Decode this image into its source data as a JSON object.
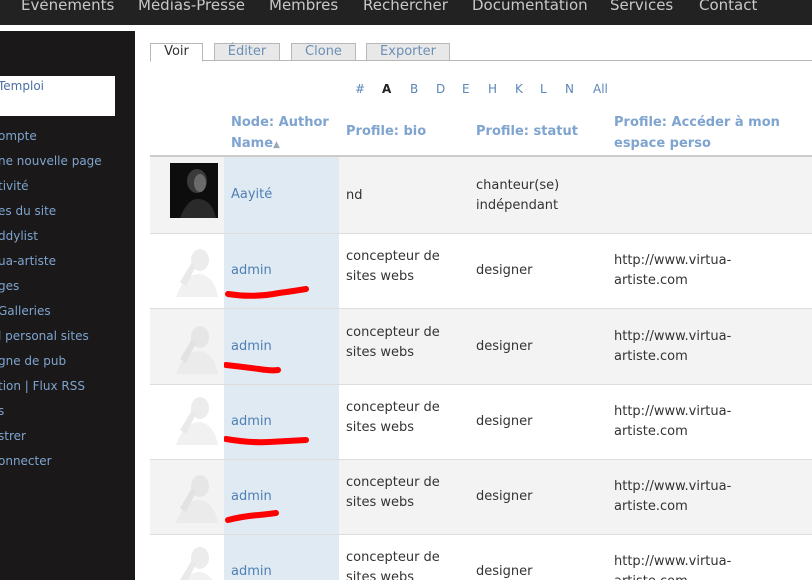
{
  "topnav": {
    "items": [
      "Evènements",
      "Médias-Presse",
      "Membres",
      "Rechercher",
      "Documentation",
      "Services",
      "Contact"
    ]
  },
  "sidebar": {
    "login_box_text": "Temploi",
    "items": [
      "ompte",
      "ne nouvelle page",
      "tivité",
      "es du site",
      "ddylist",
      "ua-artiste",
      "ges",
      "Galleries",
      "l personal sites",
      "gne de pub",
      "tion | Flux RSS",
      "s",
      "strer",
      "onnecter"
    ]
  },
  "tabs": [
    "Voir",
    "Éditer",
    "Clone",
    "Exporter"
  ],
  "letters": [
    "#",
    "A",
    "B",
    "D",
    "E",
    "H",
    "K",
    "L",
    "N",
    "All"
  ],
  "active_letter": "A",
  "table": {
    "headers": {
      "author": "Node: Author Name",
      "bio": "Profile: bio",
      "statut": "Profile: statut",
      "site": "Profile: Accéder à mon espace perso"
    },
    "rows": [
      {
        "author": "Aayité",
        "bio": "nd",
        "statut": "chanteur(se) indépendant",
        "site": ""
      },
      {
        "author": "admin",
        "bio": "concepteur de sites webs",
        "statut": "designer",
        "site": "http://www.virtua-artiste.com"
      },
      {
        "author": "admin",
        "bio": "concepteur de sites webs",
        "statut": "designer",
        "site": "http://www.virtua-artiste.com"
      },
      {
        "author": "admin",
        "bio": "concepteur de sites webs",
        "statut": "designer",
        "site": "http://www.virtua-artiste.com"
      },
      {
        "author": "admin",
        "bio": "concepteur de sites webs",
        "statut": "designer",
        "site": "http://www.virtua-artiste.com"
      },
      {
        "author": "admin",
        "bio": "concepteur de sites webs",
        "statut": "designer",
        "site": "http://www.virtua-artiste.com"
      }
    ]
  },
  "colors": {
    "nav_bg": "#222222",
    "sidebar_bg": "#1a1818",
    "link": "#4f7fb5",
    "header_text": "#7ea4cf",
    "sorted_column": "#dfeaf3",
    "scribble": "#ff0000"
  }
}
